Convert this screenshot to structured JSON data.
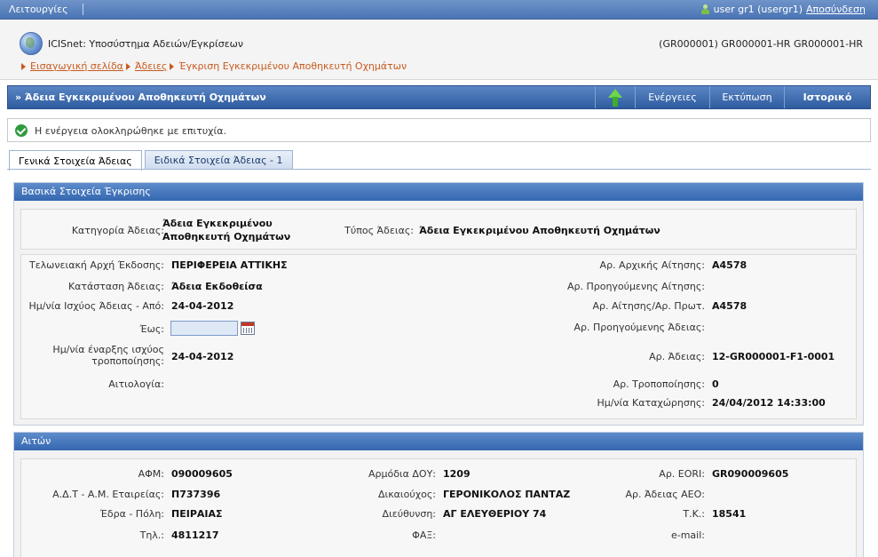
{
  "topbar": {
    "menu_label": "Λειτουργίες",
    "user_label": "user gr1 (usergr1)",
    "logout_label": "Αποσύνδεση"
  },
  "header": {
    "app_title": "ICISnet: Υποσύστημα Αδειών/Εγκρίσεων",
    "codes": "(GR000001) GR000001-HR GR000001-HR",
    "breadcrumb": [
      "Εισαγωγική σελίδα",
      "Άδειες",
      "Έγκριση Εγκεκριμένου Αποθηκευτή Οχημάτων"
    ]
  },
  "titlebar": {
    "title": "» Άδεια Εγκεκριμένου Αποθηκευτή Οχημάτων",
    "actions_label": "Ενέργειες",
    "print_label": "Εκτύπωση",
    "history_label": "Ιστορικό"
  },
  "message": {
    "text": "Η ενέργεια ολοκληρώθηκε με επιτυχία."
  },
  "tabs": [
    {
      "label": "Γενικά Στοιχεία Άδειας",
      "active": true
    },
    {
      "label": "Ειδικά Στοιχεία Άδειας - 1",
      "active": false
    }
  ],
  "panel_basic": {
    "title": "Βασικά Στοιχεία Έγκρισης",
    "category_label": "Κατηγορία Άδειας:",
    "category_value_1": "Άδεια Εγκεκριμένου",
    "category_value_2": "Αποθηκευτή Οχημάτων",
    "type_label": "Τύπος Άδειας:",
    "type_value": "Άδεια Εγκεκριμένου Αποθηκευτή Οχημάτων",
    "customs_label": "Τελωνειακή Αρχή Έκδοσης:",
    "customs_value": "ΠΕΡΙΦΕΡΕΙΑ ΑΤΤΙΚΗΣ",
    "status_label": "Κατάσταση Άδειας:",
    "status_value": "Άδεια Εκδοθείσα",
    "validity_from_label": "Ημ/νία Ισχύος Άδειας  -  Από:",
    "validity_from_value": "24-04-2012",
    "until_label": "Έως:",
    "amend_start_label_1": "Ημ/νία έναρξης ισχύος",
    "amend_start_label_2": "τροποποίησης:",
    "amend_start_value": "24-04-2012",
    "justification_label": "Αιτιολογία:",
    "initial_app_label": "Αρ. Αρχικής Αίτησης:",
    "initial_app_value": "A4578",
    "prev_app_label": "Αρ. Προηγούμενης Αίτησης:",
    "app_protocol_label": "Αρ. Αίτησης/Αρ. Πρωτ.",
    "app_protocol_value": "A4578",
    "prev_license_label": "Αρ. Προηγούμενης Άδειας:",
    "license_no_label": "Αρ. Άδειας:",
    "license_no_value": "12-GR000001-F1-0001",
    "amend_no_label": "Αρ. Τροποποίησης:",
    "amend_no_value": "0",
    "registered_label": "Ημ/νία Καταχώρησης:",
    "registered_value": "24/04/2012 14:33:00"
  },
  "panel_applicant": {
    "title": "Αιτών",
    "afm_label": "ΑΦΜ:",
    "afm_value": "090009605",
    "doy_label": "Αρμόδια ΔΟΥ:",
    "doy_value": "1209",
    "eori_label": "Αρ. EORI:",
    "eori_value": "GR090009605",
    "adt_label": "Α.Δ.Τ - Α.Μ. Εταιρείας:",
    "adt_value": "Π737396",
    "beneficiary_label": "Δικαιούχος:",
    "beneficiary_value": "ΓΕΡΟΝΙΚΟΛΟΣ ΠΑΝΤΑΖ",
    "aeo_label": "Αρ. Άδειας ΑΕΟ:",
    "seat_label": "Έδρα - Πόλη:",
    "seat_value": "ΠΕΙΡΑΙΑΣ",
    "address_label": "Διεύθυνση:",
    "address_value": "ΑΓ ΕΛΕΥΘΕΡΙΟΥ 74",
    "zip_label": "Τ.Κ.:",
    "zip_value": "18541",
    "phone_label": "Τηλ.:",
    "phone_value": "4811217",
    "fax_label": "ΦΑΞ:",
    "email_label": "e-mail:"
  }
}
